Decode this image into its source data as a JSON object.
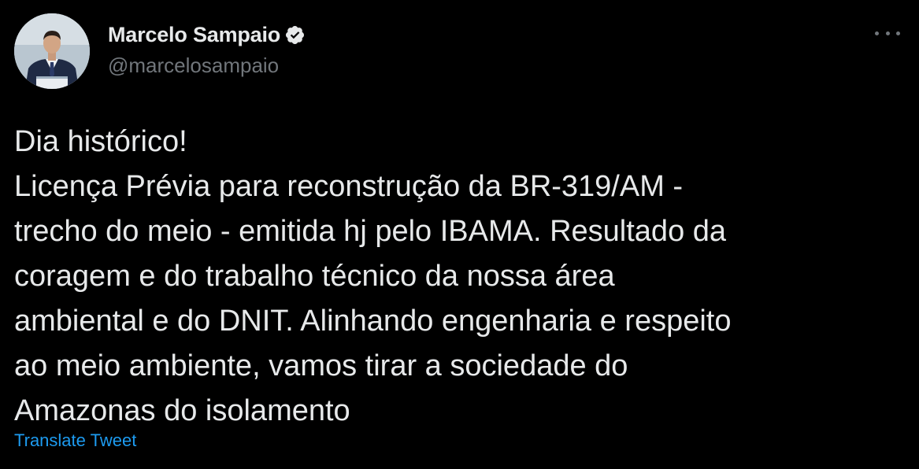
{
  "author": {
    "name": "Marcelo Sampaio",
    "handle": "@marcelosampaio",
    "verified": true
  },
  "tweet": {
    "lines": [
      "Dia histórico!",
      "Licença Prévia para reconstrução da BR-319/AM -",
      "trecho do meio - emitida hj pelo IBAMA. Resultado da",
      "coragem e do trabalho técnico da nossa área",
      "ambiental e do DNIT. Alinhando engenharia e respeito",
      "ao meio ambiente, vamos tirar a sociedade do",
      "Amazonas do isolamento"
    ]
  },
  "actions": {
    "translate_label": "Translate Tweet",
    "more_icon": "more-options-icon"
  },
  "colors": {
    "background": "#000000",
    "text": "#e7e9ea",
    "secondary_text": "#71767b",
    "link": "#1d9bf0"
  }
}
